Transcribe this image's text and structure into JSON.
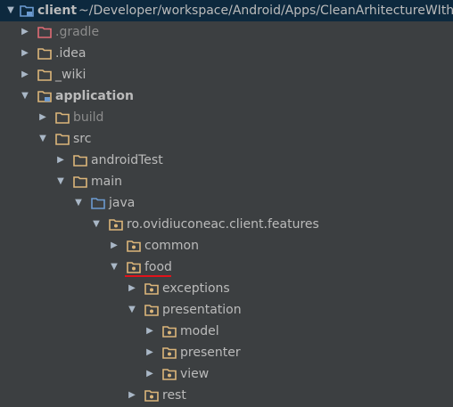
{
  "colors": {
    "folder_default": "#dcb67a",
    "folder_excluded": "#e06c75",
    "folder_source": "#6c9bd1",
    "selection_background": "#0d293e",
    "text": "#bbbbbb",
    "text_dimmed": "#8c8c8c",
    "underline": "#e2121a"
  },
  "tree": {
    "root": {
      "label": "client",
      "path": "~/Developer/workspace/Android/Apps/CleanArhitectureWIthAndr"
    },
    "items": [
      {
        "label": "gradle",
        "prefix": "."
      },
      {
        "label": ".idea"
      },
      {
        "label": "_wiki"
      },
      {
        "label": "application"
      },
      {
        "label": "build"
      },
      {
        "label": "src"
      },
      {
        "label": "androidTest"
      },
      {
        "label": "main"
      },
      {
        "label": "java"
      },
      {
        "label": "ro.ovidiuconeac.client.features"
      },
      {
        "label": "common"
      },
      {
        "label": "food"
      },
      {
        "label": "exceptions"
      },
      {
        "label": "presentation"
      },
      {
        "label": "model"
      },
      {
        "label": "presenter"
      },
      {
        "label": "view"
      },
      {
        "label": "rest"
      }
    ]
  }
}
